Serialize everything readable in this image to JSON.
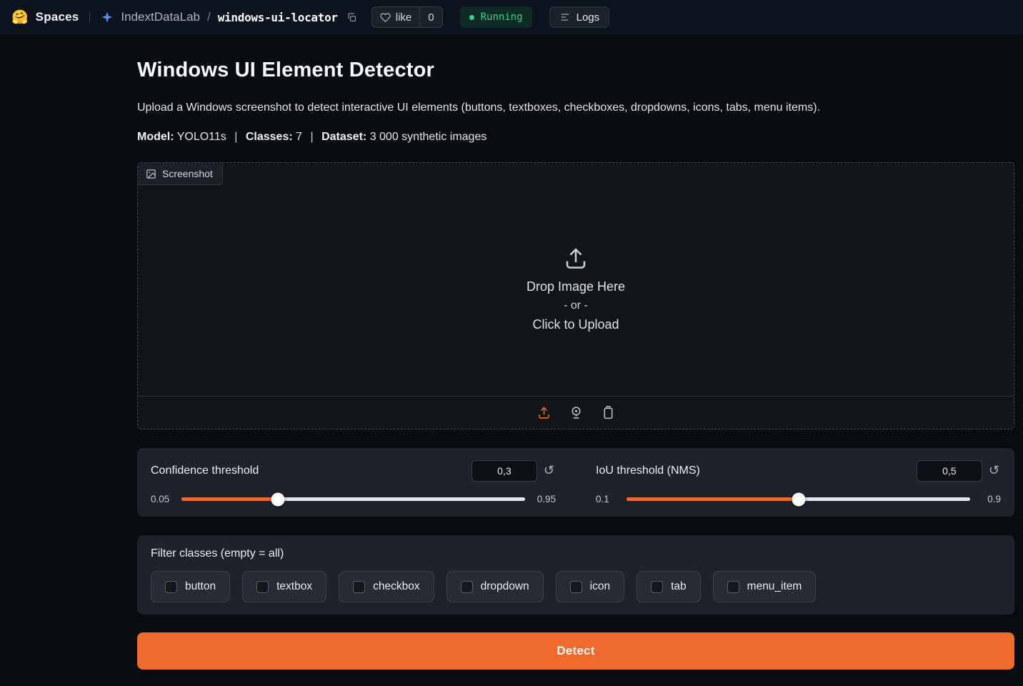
{
  "header": {
    "logo": "🤗",
    "brand": "Spaces",
    "org": "IndextDataLab",
    "slash": "/",
    "space": "windows-ui-locator",
    "like": {
      "label": "like",
      "count": "0"
    },
    "status": "Running",
    "logs": "Logs"
  },
  "page": {
    "title": "Windows UI Element Detector",
    "description": "Upload a Windows screenshot to detect interactive UI elements (buttons, textboxes, checkboxes, dropdowns, icons, tabs, menu items).",
    "meta": {
      "model_label": "Model:",
      "model": "YOLO11s",
      "sep1": "|",
      "classes_label": "Classes:",
      "classes": "7",
      "sep2": "|",
      "dataset_label": "Dataset:",
      "dataset": "3 000 synthetic images"
    }
  },
  "upload": {
    "label": "Screenshot",
    "drop": "Drop Image Here",
    "or": "- or -",
    "click": "Click to Upload"
  },
  "sliders": [
    {
      "label": "Confidence threshold",
      "value": "0,3",
      "min": "0.05",
      "max": "0.95",
      "percent": 28
    },
    {
      "label": "IoU threshold (NMS)",
      "value": "0,5",
      "min": "0.1",
      "max": "0.9",
      "percent": 50
    }
  ],
  "filters": {
    "label": "Filter classes (empty = all)",
    "options": [
      "button",
      "textbox",
      "checkbox",
      "dropdown",
      "icon",
      "tab",
      "menu_item"
    ]
  },
  "actions": {
    "detect": "Detect"
  },
  "colors": {
    "accent": "#ee6a2c",
    "status_green": "#3ecf8e"
  }
}
